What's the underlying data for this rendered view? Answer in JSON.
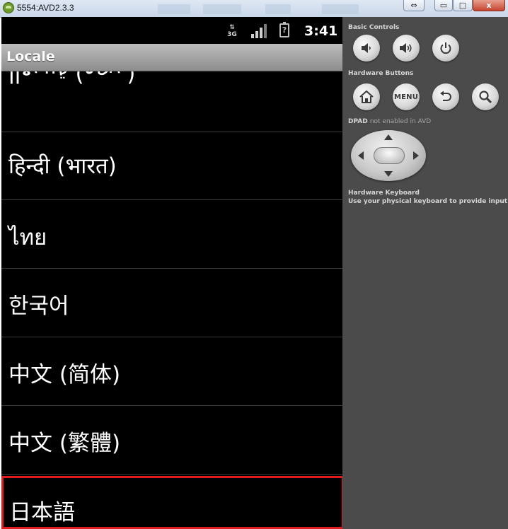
{
  "window": {
    "title": "5554:AVD2.3.3",
    "controls": {
      "restore": "⇔",
      "minimize": "▭",
      "maximize": "□",
      "close": "x"
    }
  },
  "status_bar": {
    "network": "3G",
    "battery": "?",
    "time": "3:41"
  },
  "app_bar": {
    "title": "Locale"
  },
  "locales": [
    {
      "label": "العربية (مصر)",
      "selected": false
    },
    {
      "label": "हिन्दी (भारत)",
      "selected": false
    },
    {
      "label": "ไทย",
      "selected": false
    },
    {
      "label": "한국어",
      "selected": false
    },
    {
      "label": "中文 (简体)",
      "selected": false
    },
    {
      "label": "中文 (繁體)",
      "selected": false
    },
    {
      "label": "日本語",
      "selected": true
    }
  ],
  "panel": {
    "basic_controls_title": "Basic Controls",
    "hardware_buttons_title": "Hardware Buttons",
    "menu_label": "MENU",
    "dpad_title": "DPAD",
    "dpad_note": "not enabled in AVD",
    "keyboard_title": "Hardware Keyboard",
    "keyboard_note": "Use your physical keyboard to provide input"
  },
  "colors": {
    "highlight": "#e11b1b",
    "panel_bg": "#4b4b4b",
    "app_bar": "#a5a5a5"
  }
}
